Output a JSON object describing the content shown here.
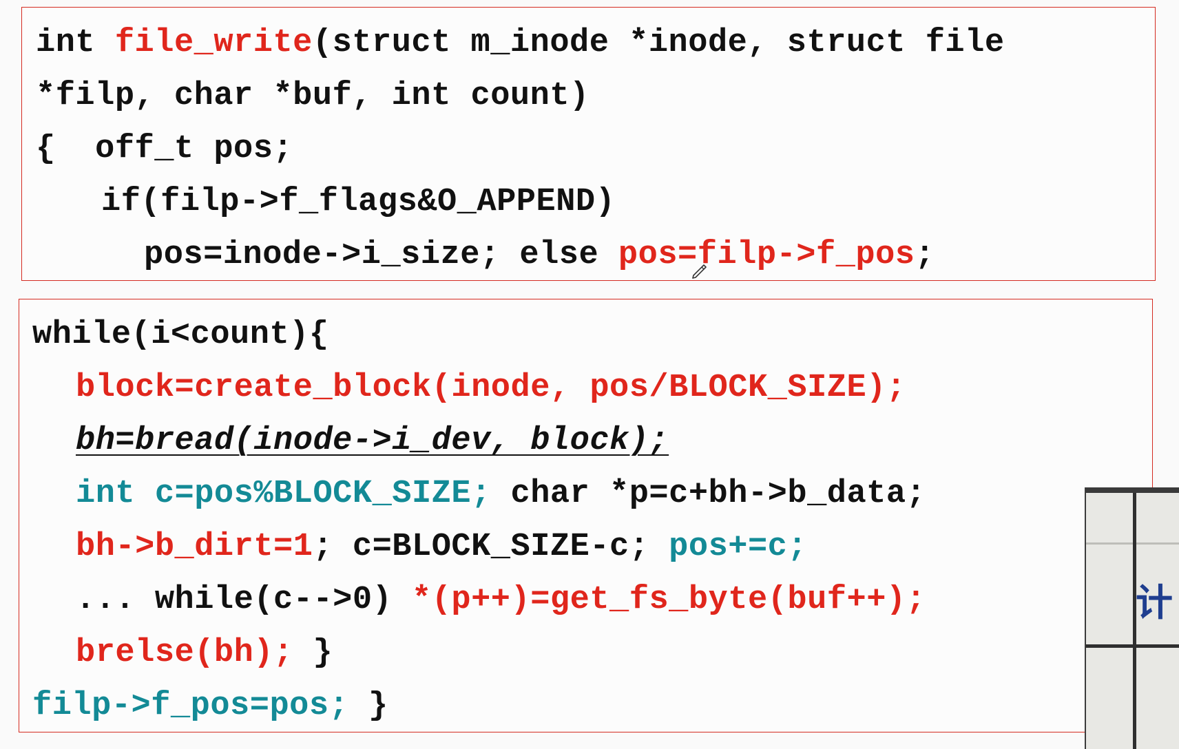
{
  "box1": {
    "line1": {
      "a": "int ",
      "b": "file_write",
      "c": "(struct m_inode *inode, struct file"
    },
    "line2": "*filp, char *buf, int count)",
    "line3": "{  off_t pos;",
    "line4": "if(filp->f_flags&O_APPEND)",
    "line5": {
      "a": "pos=inode->i_size; else ",
      "b": "pos=filp->f_pos",
      "c": ";"
    }
  },
  "box2": {
    "line1": "while(i<count){",
    "line2": "block=create_block(inode, pos/BLOCK_SIZE);",
    "line3": "bh=bread(inode->i_dev, block);",
    "line4": {
      "a": "int c=pos%BLOCK_SIZE;",
      "b": " char *p=c+bh->b_data;"
    },
    "line5": {
      "a": "bh->b_dirt=1",
      "b": "; c=BLOCK_SIZE-c; ",
      "c": "pos+=c;"
    },
    "line6": {
      "a": "... while(c-->0) ",
      "b": "*(p++)=get_fs_byte(buf++);"
    },
    "line7": {
      "a": "brelse(bh);",
      "b": " }"
    },
    "line8": {
      "a": "filp->f_pos=pos;",
      "b": " }"
    }
  },
  "webcam": {
    "visible_char": "计"
  },
  "colors": {
    "red": "#e0261c",
    "teal": "#138a96",
    "black": "#111111",
    "border": "#d42a20"
  },
  "icons": {
    "cursor": "pen-cursor-icon"
  }
}
